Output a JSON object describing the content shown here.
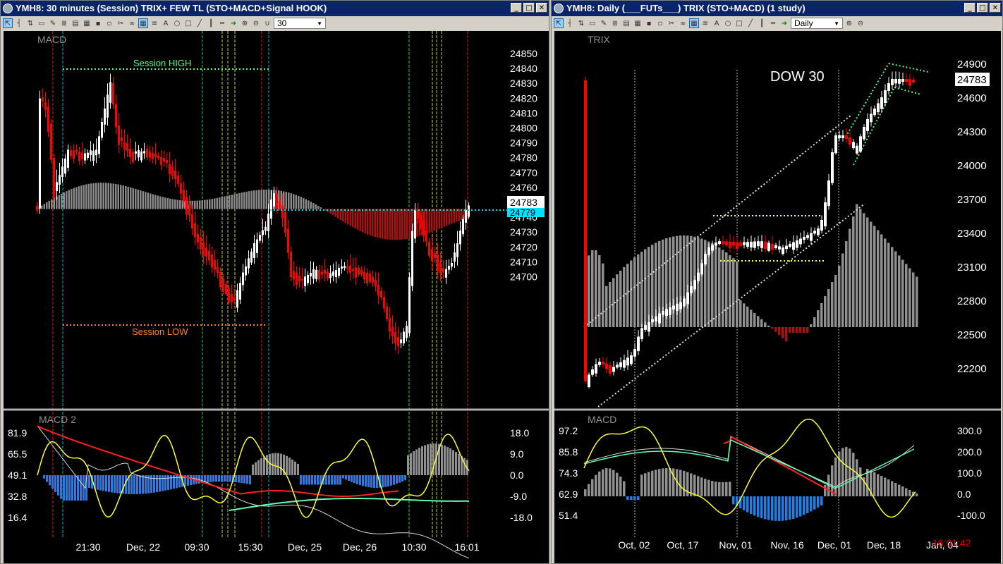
{
  "left_window": {
    "title": "YMH8: 30 minutes (Session)  TRIX+ FEW TL (STO+MACD+Signal HOOK)",
    "timeframe": "30 minutes",
    "price_pane_label": "MACD",
    "annotation_high": "Session HIGH",
    "annotation_low": "Session LOW",
    "last_price": "24783",
    "marker_price": "24779",
    "indicator_pane_label": "MACD 2",
    "price_axis": [
      "24850",
      "24840",
      "24830",
      "24820",
      "24810",
      "24800",
      "24790",
      "24780",
      "24770",
      "24760",
      "24750",
      "24740",
      "24730",
      "24720",
      "24710",
      "24700"
    ],
    "left_ind_axis": [
      "81.9",
      "65.5",
      "49.1",
      "32.8",
      "16.4"
    ],
    "right_ind_axis": [
      "18.0",
      "9.0",
      "0.0",
      "-9.0",
      "-18.0"
    ],
    "time_axis": [
      "21:30",
      "Dec, 22",
      "09:30",
      "15:30",
      "Dec, 25",
      "Dec, 26",
      "10:30",
      "16:01"
    ]
  },
  "right_window": {
    "title": "YMH8: Daily (___FUTs___)  TRIX (STO+MACD)  (1 study)",
    "timeframe": "Daily",
    "price_pane_label": "TRIX",
    "instrument_label": "DOW 30",
    "last_price": "24783",
    "indicator_pane_label": "MACD",
    "price_axis": [
      "24900",
      "24600",
      "24300",
      "24000",
      "23700",
      "23400",
      "23100",
      "22800",
      "22500",
      "22200"
    ],
    "left_ind_axis": [
      "97.2",
      "85.8",
      "74.3",
      "62.9",
      "51.4"
    ],
    "right_ind_axis": [
      "300.0",
      "200.0",
      "100.0",
      "0.0",
      "-100.0"
    ],
    "time_axis": [
      "Oct, 02",
      "Oct, 17",
      "Nov, 01",
      "Nov, 16",
      "Dec, 01",
      "Dec, 18",
      "Jan, 04"
    ],
    "clock": "16:01:42"
  },
  "colors": {
    "bull": "#ffffff",
    "bear": "#ff0000",
    "hist_pos": "#909090",
    "hist_neg": "#aa1111",
    "hist_blue": "#1e7fe6",
    "cyan": "#00e0ff",
    "yellow": "#ffff30",
    "green": "#50ff80",
    "orange": "#ff8020"
  }
}
